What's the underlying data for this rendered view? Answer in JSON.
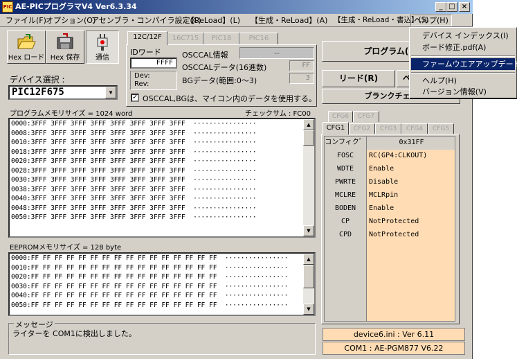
{
  "window": {
    "title": "AE-PICプログラマV4  Ver6.3.34",
    "app_icon_text": "PIC"
  },
  "title_buttons": {
    "minimize": "_",
    "maximize": "□",
    "close": "×"
  },
  "menu": [
    "ファイル(F)",
    "オプション(O)",
    "アセンブラ・コンパイラ設定(C)",
    "【ReLoad】(L)",
    "【生成・ReLoad】(A)",
    "【生成・ReLoad・書込】(S)",
    "ヘルプ(H)"
  ],
  "help_menu": {
    "items": [
      "デバイス インデックス(I)",
      "ボード修正.pdf(A)",
      "ファームウエアアップデート",
      "ヘルプ(H)",
      "バージョン情報(V)"
    ]
  },
  "toolbar": {
    "hex_load": "Hex ロード",
    "hex_save": "Hex 保存",
    "connect": "通信"
  },
  "device": {
    "label": "デバイス選択 :",
    "value": "PIC12F675"
  },
  "device_tabs": [
    "12C/12F",
    "16C715",
    "PIC18",
    "PIC16"
  ],
  "id_word": {
    "label": "IDワード",
    "value": "FFFF"
  },
  "dev_rev": {
    "dev": "Dev:",
    "rev": "Rev:"
  },
  "osccal": {
    "info_label": "OSCCAL情報",
    "info_value": "--",
    "data_label": "OSCCALデータ(16進数)",
    "data_value": "FF",
    "bg_label": "BGデータ(範囲:0～3)",
    "bg_value": "3",
    "checkbox_label": "OSCCAL,BGは、マイコン内のデータを使用する。"
  },
  "program_memory": {
    "label": "プログラムメモリサイズ = 1024 word",
    "checksum": "チェックサム : FC00",
    "lines": [
      "0000:3FFF 3FFF 3FFF 3FFF 3FFF 3FFF 3FFF 3FFF  ················",
      "0008:3FFF 3FFF 3FFF 3FFF 3FFF 3FFF 3FFF 3FFF  ················",
      "0010:3FFF 3FFF 3FFF 3FFF 3FFF 3FFF 3FFF 3FFF  ················",
      "0018:3FFF 3FFF 3FFF 3FFF 3FFF 3FFF 3FFF 3FFF  ················",
      "0020:3FFF 3FFF 3FFF 3FFF 3FFF 3FFF 3FFF 3FFF  ················",
      "0028:3FFF 3FFF 3FFF 3FFF 3FFF 3FFF 3FFF 3FFF  ················",
      "0030:3FFF 3FFF 3FFF 3FFF 3FFF 3FFF 3FFF 3FFF  ················",
      "0038:3FFF 3FFF 3FFF 3FFF 3FFF 3FFF 3FFF 3FFF  ················",
      "0040:3FFF 3FFF 3FFF 3FFF 3FFF 3FFF 3FFF 3FFF  ················",
      "0048:3FFF 3FFF 3FFF 3FFF 3FFF 3FFF 3FFF 3FFF  ················",
      "0050:3FFF 3FFF 3FFF 3FFF 3FFF 3FFF 3FFF 3FFF  ················"
    ]
  },
  "eeprom_memory": {
    "label": "EEPROMメモリサイズ = 128 byte",
    "lines": [
      "0000:FF FF FF FF FF FF FF FF FF FF FF FF FF FF FF FF  ················",
      "0010:FF FF FF FF FF FF FF FF FF FF FF FF FF FF FF FF  ················",
      "0020:FF FF FF FF FF FF FF FF FF FF FF FF FF FF FF FF  ················",
      "0030:FF FF FF FF FF FF FF FF FF FF FF FF FF FF FF FF  ················",
      "0040:FF FF FF FF FF FF FF FF FF FF FF FF FF FF FF FF  ················",
      "0050:FF FF FF FF FF FF FF FF FF FF FF FF FF FF FF FF  ················"
    ]
  },
  "message": {
    "label": "メッセージ",
    "text": "ライターを COM1に検出しました。"
  },
  "actions": {
    "program": "プログラム(P)",
    "read": "リード(R)",
    "verify_partial": "ベ",
    "blank_check": "ブランクチェッ"
  },
  "cfg_tabs_top": [
    "CFG6",
    "CFG7"
  ],
  "cfg_tabs": [
    "CFG1",
    "CFG2",
    "CFG3",
    "CFG4",
    "CFG5"
  ],
  "config_table": {
    "header": [
      "コンフィク゛1",
      "0x31FF"
    ],
    "rows": [
      [
        "FOSC",
        "RC(GP4:CLKOUT)"
      ],
      [
        "WDTE",
        "Enable"
      ],
      [
        "PWRTE",
        "Disable"
      ],
      [
        "MCLRE",
        "MCLRpin"
      ],
      [
        "BODEN",
        "Enable"
      ],
      [
        "CP",
        "NotProtected"
      ],
      [
        "CPD",
        "NotProtected"
      ]
    ]
  },
  "status": {
    "device_ini": "device6.ini : Ver 6.11",
    "com": "COM1 : AE-PGM877 V6.22"
  },
  "colors": {
    "title_start": "#0a246a",
    "cfg_value_bg": "#ffdcb4",
    "face": "#d4d0c8"
  }
}
